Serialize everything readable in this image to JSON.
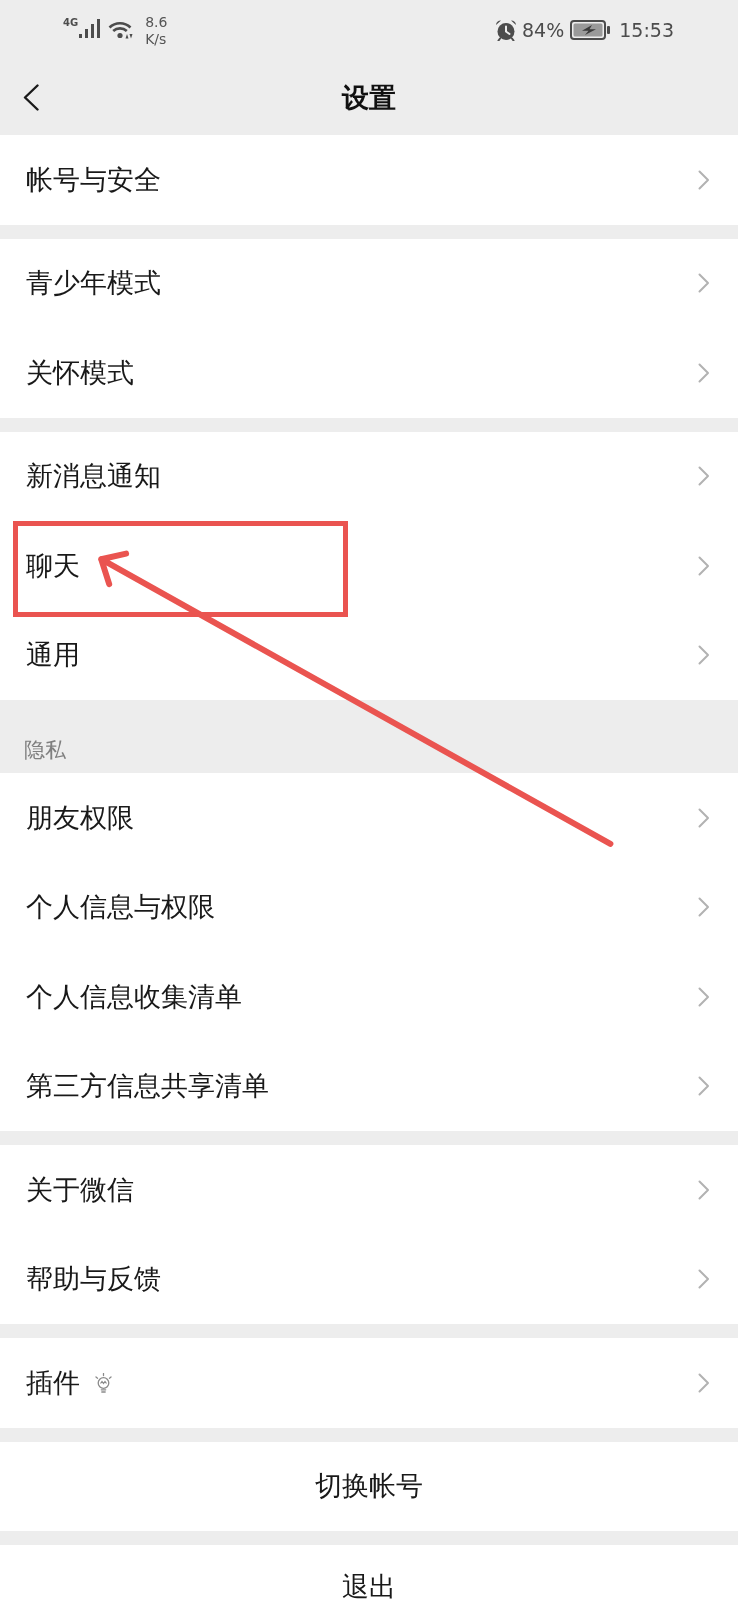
{
  "status_bar": {
    "network": "4G",
    "speed_value": "8.6",
    "speed_unit": "K/s",
    "battery": "84%",
    "time": "15:53"
  },
  "nav": {
    "title": "设置"
  },
  "groups": [
    {
      "items": [
        {
          "label": "帐号与安全",
          "kind": "plain",
          "highlighted": false
        }
      ]
    },
    {
      "items": [
        {
          "label": "青少年模式",
          "kind": "plain",
          "highlighted": false
        },
        {
          "label": "关怀模式",
          "kind": "plain",
          "highlighted": false
        }
      ]
    },
    {
      "items": [
        {
          "label": "新消息通知",
          "kind": "plain",
          "highlighted": false
        },
        {
          "label": "聊天",
          "kind": "plain",
          "highlighted": true
        },
        {
          "label": "通用",
          "kind": "plain",
          "highlighted": false
        }
      ]
    },
    {
      "header": "隐私",
      "items": [
        {
          "label": "朋友权限",
          "kind": "plain",
          "highlighted": false
        },
        {
          "label": "个人信息与权限",
          "kind": "plain",
          "highlighted": false
        },
        {
          "label": "个人信息收集清单",
          "kind": "plain",
          "highlighted": false
        },
        {
          "label": "第三方信息共享清单",
          "kind": "plain",
          "highlighted": false
        }
      ]
    },
    {
      "items": [
        {
          "label": "关于微信",
          "kind": "plain",
          "highlighted": false
        },
        {
          "label": "帮助与反馈",
          "kind": "plain",
          "highlighted": false
        }
      ]
    },
    {
      "items": [
        {
          "label": "插件",
          "kind": "icon",
          "highlighted": false
        }
      ]
    }
  ],
  "actions": [
    {
      "label": "切换帐号"
    },
    {
      "label": "退出"
    }
  ]
}
